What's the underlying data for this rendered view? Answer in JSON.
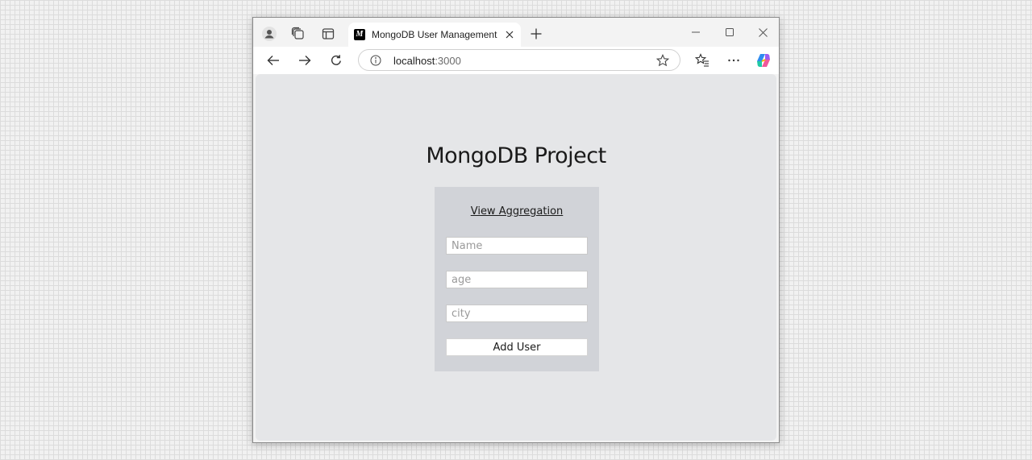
{
  "browser": {
    "tab": {
      "title": "MongoDB User Management",
      "favicon_letter": "M"
    },
    "address": {
      "host": "localhost",
      "port": ":3000"
    }
  },
  "page": {
    "title": "MongoDB Project",
    "form": {
      "aggregation_link": "View Aggregation",
      "name_placeholder": "Name",
      "age_placeholder": "age",
      "city_placeholder": "city",
      "submit_label": "Add User"
    }
  },
  "icons": {
    "profile": "profile-icon",
    "workspaces": "workspaces-icon",
    "vertical_tabs": "vertical-tabs-icon",
    "close": "close-icon",
    "new_tab": "plus-icon",
    "minimize": "minimize-icon",
    "maximize": "maximize-icon",
    "window_close": "close-icon",
    "back": "back-arrow-icon",
    "forward": "forward-arrow-icon",
    "refresh": "refresh-icon",
    "info": "info-icon",
    "favorite": "star-icon",
    "favorites_list": "favorites-icon",
    "more": "ellipsis-icon",
    "copilot": "copilot-icon"
  },
  "colors": {
    "viewport_background": "#e5e6e8",
    "card_background": "#d1d3d8",
    "chrome_background": "#f3f3f3"
  }
}
